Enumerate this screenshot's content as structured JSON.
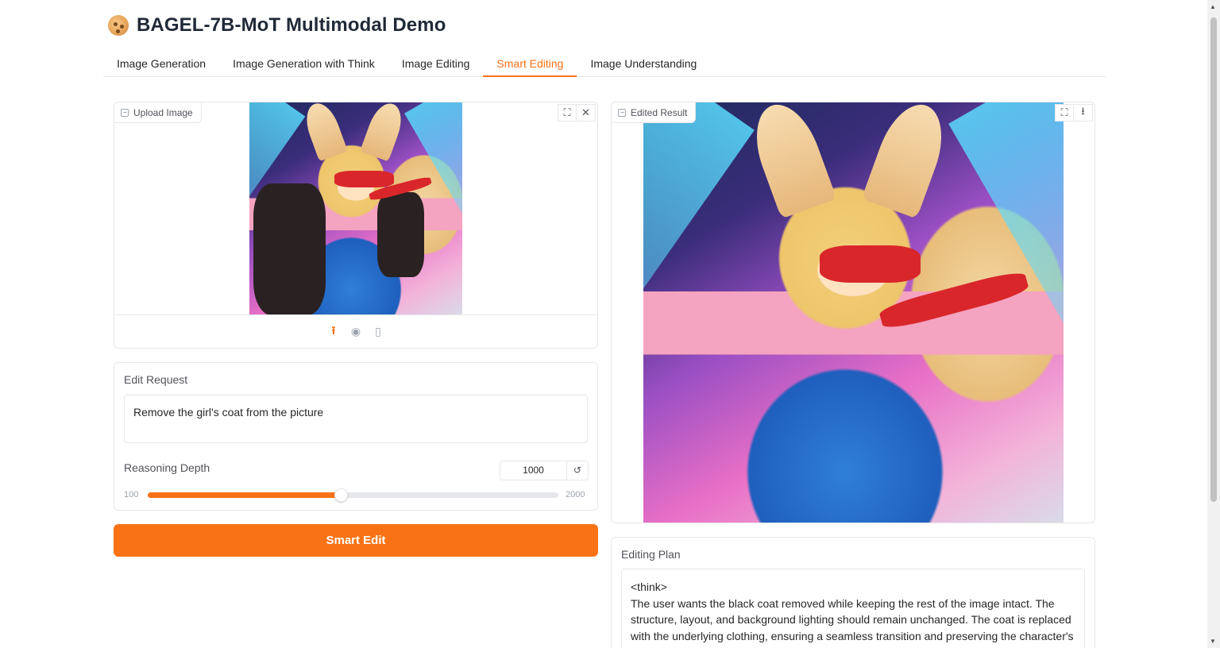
{
  "app": {
    "title": "BAGEL-7B-MoT Multimodal Demo"
  },
  "tabs": [
    {
      "label": "Image Generation",
      "active": false
    },
    {
      "label": "Image Generation with Think",
      "active": false
    },
    {
      "label": "Image Editing",
      "active": false
    },
    {
      "label": "Smart Editing",
      "active": true
    },
    {
      "label": "Image Understanding",
      "active": false
    }
  ],
  "upload_panel": {
    "label": "Upload Image"
  },
  "edit_request": {
    "label": "Edit Request",
    "value": "Remove the girl's coat from the picture"
  },
  "reasoning_depth": {
    "label": "Reasoning Depth",
    "value": "1000",
    "min": "100",
    "max": "2000",
    "fraction": 0.47
  },
  "smart_edit_button": {
    "label": "Smart Edit"
  },
  "result_panel": {
    "label": "Edited Result"
  },
  "editing_plan": {
    "label": "Editing Plan",
    "lines": [
      "<think>",
      "The user wants the black coat removed while keeping the rest of the image intact. The structure, layout, and background lighting should remain unchanged. The coat is replaced with the underlying clothing, ensuring a seamless transition and preserving the character's pose and accessories."
    ]
  },
  "colors": {
    "accent": "#f97316",
    "border": "#e5e7eb",
    "text": "#27272a"
  },
  "icons": {
    "fullscreen": "fullscreen-icon",
    "close": "close-icon",
    "download": "download-icon",
    "upload": "upload-icon",
    "webcam": "webcam-icon",
    "clipboard": "clipboard-icon",
    "reset": "reset-icon"
  }
}
